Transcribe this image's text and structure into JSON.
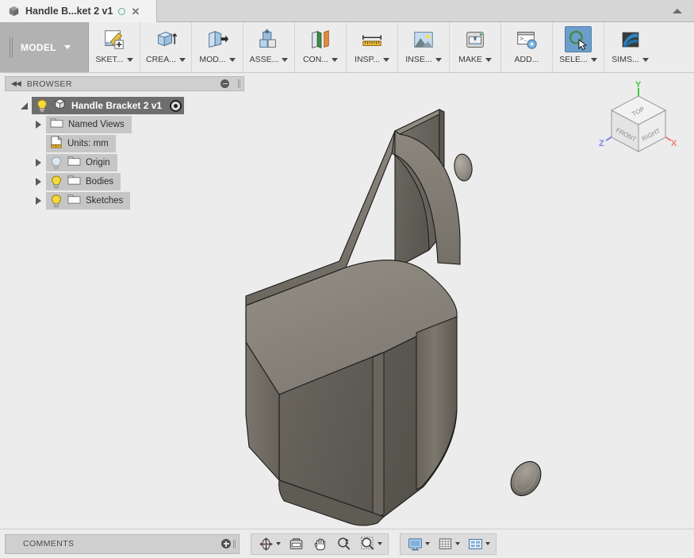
{
  "window": {
    "tab_title": "Handle B...ket 2 v1",
    "tab_dot_icon": "unsaved-dot-icon",
    "tab_close_icon": "close-icon",
    "collapse_icon": "chevron-up-icon"
  },
  "toolbar": {
    "workspace_label": "MODEL",
    "items": [
      {
        "label": "SKET...",
        "icon": "sketch-icon",
        "dropdown": true,
        "selected": false
      },
      {
        "label": "CREA...",
        "icon": "create-extrude-icon",
        "dropdown": true,
        "selected": false
      },
      {
        "label": "MOD...",
        "icon": "modify-press-pull-icon",
        "dropdown": true,
        "selected": false
      },
      {
        "label": "ASSE...",
        "icon": "assemble-icon",
        "dropdown": true,
        "selected": false
      },
      {
        "label": "CON...",
        "icon": "construct-plane-icon",
        "dropdown": true,
        "selected": false
      },
      {
        "label": "INSP...",
        "icon": "inspect-ruler-icon",
        "dropdown": true,
        "selected": false
      },
      {
        "label": "INSE...",
        "icon": "insert-image-icon",
        "dropdown": true,
        "selected": false
      },
      {
        "label": "MAKE",
        "icon": "make-3d-print-icon",
        "dropdown": true,
        "selected": false
      },
      {
        "label": "ADD...",
        "icon": "add-ins-script-icon",
        "dropdown": false,
        "selected": false
      },
      {
        "label": "SELE...",
        "icon": "select-lasso-icon",
        "dropdown": true,
        "selected": true
      },
      {
        "label": "SIMS...",
        "icon": "simulation-icon",
        "dropdown": true,
        "selected": false
      }
    ]
  },
  "browser": {
    "panel_title": "BROWSER",
    "collapse_icon": "double-left-arrow-icon",
    "minimize_icon": "minus-circle-icon",
    "nodes": [
      {
        "label": "Handle Bracket 2 v1",
        "indent": 0,
        "arrow": "open",
        "bulb": "on",
        "icon": "component-cube-icon",
        "selected": true,
        "target": true
      },
      {
        "label": "Named Views",
        "indent": 1,
        "arrow": "closed",
        "bulb": "none",
        "icon": "folder-icon",
        "selected": false,
        "target": false
      },
      {
        "label": "Units: mm",
        "indent": 1,
        "arrow": "none",
        "bulb": "none",
        "icon": "units-document-icon",
        "selected": false,
        "target": false
      },
      {
        "label": "Origin",
        "indent": 1,
        "arrow": "closed",
        "bulb": "off",
        "icon": "folder-icon",
        "selected": false,
        "target": false
      },
      {
        "label": "Bodies",
        "indent": 1,
        "arrow": "closed",
        "bulb": "on",
        "icon": "folder-icon",
        "selected": false,
        "target": false
      },
      {
        "label": "Sketches",
        "indent": 1,
        "arrow": "closed",
        "bulb": "on",
        "icon": "folder-icon",
        "selected": false,
        "target": false
      }
    ]
  },
  "viewcube": {
    "top_face": "TOP",
    "front_face": "FRONT",
    "right_face": "RIGHT",
    "axis_y": "Y",
    "axis_x": "X",
    "axis_z": "Z",
    "axis_y_color": "#3cc93c",
    "axis_x_color": "#f07b7b",
    "axis_z_color": "#7b85f0"
  },
  "model": {
    "name": "Handle Bracket 2",
    "face_top_color": "#8a857b",
    "face_front_color": "#605d56",
    "face_side_color": "#6d6961",
    "edge_color": "#1a1a1a",
    "background_color": "#ececec"
  },
  "bottom": {
    "comments_label": "COMMENTS",
    "add_comment_icon": "plus-circle-icon",
    "nav_tools": [
      {
        "icon": "orbit-icon",
        "dropdown": true
      },
      {
        "icon": "look-at-icon",
        "dropdown": false
      },
      {
        "icon": "pan-hand-icon",
        "dropdown": false
      },
      {
        "icon": "zoom-magnifier-icon",
        "dropdown": false
      },
      {
        "icon": "zoom-window-icon",
        "dropdown": true
      }
    ],
    "display_tools": [
      {
        "icon": "display-settings-monitor-icon",
        "dropdown": true
      },
      {
        "icon": "grid-snaps-icon",
        "dropdown": true
      },
      {
        "icon": "viewport-layout-icon",
        "dropdown": true
      }
    ]
  }
}
